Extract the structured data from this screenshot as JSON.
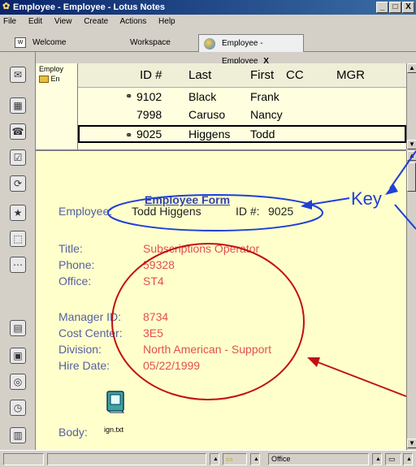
{
  "window": {
    "title": "Employee - Employee - Lotus Notes",
    "buttons": [
      "_",
      "□",
      "X"
    ]
  },
  "menu": [
    "File",
    "Edit",
    "View",
    "Create",
    "Actions",
    "Help"
  ],
  "tabs": [
    {
      "label": "Welcome"
    },
    {
      "label": "Workspace"
    },
    {
      "label": "Employee - Employee",
      "close": "X"
    }
  ],
  "nav": {
    "title": "Employ",
    "item": "En"
  },
  "view": {
    "columns": [
      "ID #",
      "Last",
      "First",
      "CC",
      "MGR"
    ],
    "rows": [
      {
        "id": "9102",
        "last": "Black",
        "first": "Frank",
        "icon": true
      },
      {
        "id": "7998",
        "last": "Caruso",
        "first": "Nancy",
        "icon": false
      },
      {
        "id": "9025",
        "last": "Higgens",
        "first": "Todd",
        "icon": true
      }
    ]
  },
  "form": {
    "heading": "Employee Form",
    "employee_label": "Employee:",
    "employee_value": "Todd Higgens",
    "id_label": "ID #:",
    "id_value": "9025",
    "title_label": "Title:",
    "title_value": "Subscriptions Operator",
    "phone_label": "Phone:",
    "phone_value": "59328",
    "office_label": "Office:",
    "office_value": "ST4",
    "manager_label": "Manager ID:",
    "manager_value": "8734",
    "cost_label": "Cost Center:",
    "cost_value": "3E5",
    "division_label": "Division:",
    "division_value": "North American - Support",
    "hire_label": "Hire Date:",
    "hire_value": "05/22/1999",
    "body_label": "Body:",
    "attachment_name": "ign.txt"
  },
  "annotation": {
    "label": "Key"
  },
  "status": {
    "location": "Office"
  },
  "colors": {
    "annotation_blue": "#1f3fd8",
    "annotation_red": "#c01010",
    "value_red": "#e05050",
    "label_blue": "#5560a0"
  }
}
